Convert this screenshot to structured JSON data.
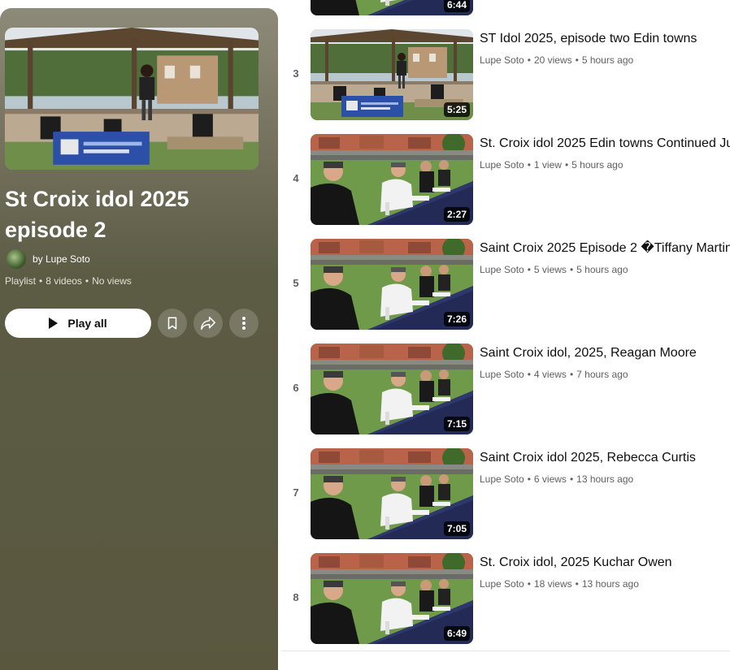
{
  "playlist": {
    "title": "St Croix idol 2025 episode 2",
    "owner": "by Lupe Soto",
    "kind": "Playlist",
    "video_count": "8 videos",
    "views": "No views",
    "play_all_label": "Play all"
  },
  "top_partial": {
    "duration": "6:44"
  },
  "videos": [
    {
      "index": "3",
      "title": "ST Idol 2025, episode two Edin towns",
      "channel": "Lupe Soto",
      "views": "20 views",
      "age": "5 hours ago",
      "duration": "5:25"
    },
    {
      "index": "4",
      "title": "St. Croix idol 2025 Edin towns Continued Ju",
      "channel": "Lupe Soto",
      "views": "1 view",
      "age": "5 hours ago",
      "duration": "2:27"
    },
    {
      "index": "5",
      "title": "Saint Croix 2025 Episode 2 �Tiffany Martin",
      "channel": "Lupe Soto",
      "views": "5 views",
      "age": "5 hours ago",
      "duration": "7:26"
    },
    {
      "index": "6",
      "title": "Saint Croix idol, 2025, Reagan Moore",
      "channel": "Lupe Soto",
      "views": "4 views",
      "age": "7 hours ago",
      "duration": "7:15"
    },
    {
      "index": "7",
      "title": "Saint Croix idol 2025, Rebecca Curtis",
      "channel": "Lupe Soto",
      "views": "6 views",
      "age": "13 hours ago",
      "duration": "7:05"
    },
    {
      "index": "8",
      "title": "St. Croix idol, 2025 Kuchar Owen",
      "channel": "Lupe Soto",
      "views": "18 views",
      "age": "13 hours ago",
      "duration": "6:49"
    }
  ],
  "icons": {
    "play": "play-icon",
    "save": "bookmark-icon",
    "share": "share-icon",
    "more": "more-vert-icon"
  }
}
